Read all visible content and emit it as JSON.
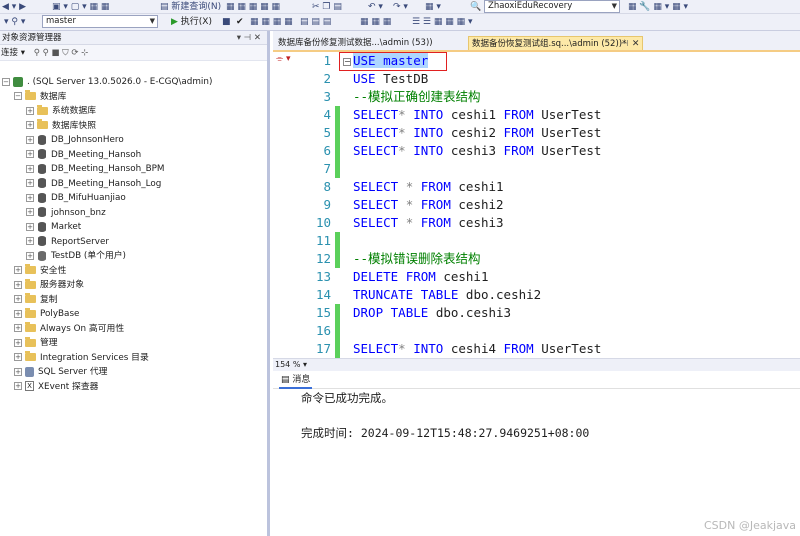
{
  "toolbar": {
    "new_query": "新建查询(N)",
    "execute": "执行(X)",
    "db_combo": "master",
    "solution_combo": "ZhaoxiEduRecovery"
  },
  "object_explorer": {
    "title": "对象资源管理器",
    "connect": "连接",
    "server": ". (SQL Server 13.0.5026.0 - E-CGQ\\admin)",
    "databases": "数据库",
    "system_db": "系统数据库",
    "snapshots": "数据库快照",
    "db_items": [
      "DB_JohnsonHero",
      "DB_Meeting_Hansoh",
      "DB_Meeting_Hansoh_BPM",
      "DB_Meeting_Hansoh_Log",
      "DB_MifuHuanjiao",
      "johnson_bnz",
      "Market",
      "ReportServer"
    ],
    "testdb": "TestDB (单个用户)",
    "server_folders": [
      "安全性",
      "服务器对象",
      "复制",
      "PolyBase",
      "Always On 高可用性",
      "管理",
      "Integration Services 目录"
    ],
    "sql_agent": "SQL Server 代理",
    "xevent": "XEvent 探查器"
  },
  "tabs": {
    "tab1": "数据库备份修复测试数据...\\admin (53))",
    "tab2": "数据备份恢复测试组.sq...\\admin (52))*"
  },
  "editor": {
    "lines": [
      {
        "n": "1",
        "bar": "#ffffff"
      },
      {
        "n": "2",
        "bar": "#ffffff"
      },
      {
        "n": "3",
        "bar": "#ffffff"
      },
      {
        "n": "4",
        "bar": "#5bd05b"
      },
      {
        "n": "5",
        "bar": "#5bd05b"
      },
      {
        "n": "6",
        "bar": "#5bd05b"
      },
      {
        "n": "7",
        "bar": "#5bd05b"
      },
      {
        "n": "8",
        "bar": "#ffffff"
      },
      {
        "n": "9",
        "bar": "#ffffff"
      },
      {
        "n": "10",
        "bar": "#ffffff"
      },
      {
        "n": "11",
        "bar": "#5bd05b"
      },
      {
        "n": "12",
        "bar": "#5bd05b"
      },
      {
        "n": "13",
        "bar": "#ffffff"
      },
      {
        "n": "14",
        "bar": "#ffffff"
      },
      {
        "n": "15",
        "bar": "#5bd05b"
      },
      {
        "n": "16",
        "bar": "#5bd05b"
      },
      {
        "n": "17",
        "bar": "#5bd05b"
      }
    ],
    "kw_use": "USE",
    "master": "master",
    "testdb": "TestDB",
    "comment1": "--模拟正确创建表结构",
    "kw_select": "SELECT",
    "kw_into": "INTO",
    "kw_from": "FROM",
    "star": "*",
    "usertest": "UserTest",
    "ceshi1": "ceshi1",
    "ceshi2": "ceshi2",
    "ceshi3": "ceshi3",
    "ceshi4": "ceshi4",
    "comment2": "--模拟错误删除表结构",
    "kw_delete": "DELETE",
    "kw_truncate": "TRUNCATE",
    "kw_table": "TABLE",
    "kw_drop": "DROP",
    "dbo_ceshi2": "dbo.ceshi2",
    "dbo_ceshi3": "dbo.ceshi3"
  },
  "zoom": "154 %",
  "messages": {
    "tab": "消息",
    "line1": "命令已成功完成。",
    "line2": "完成时间: 2024-09-12T15:48:27.9469251+08:00"
  },
  "watermark": "CSDN @Jeakjava"
}
